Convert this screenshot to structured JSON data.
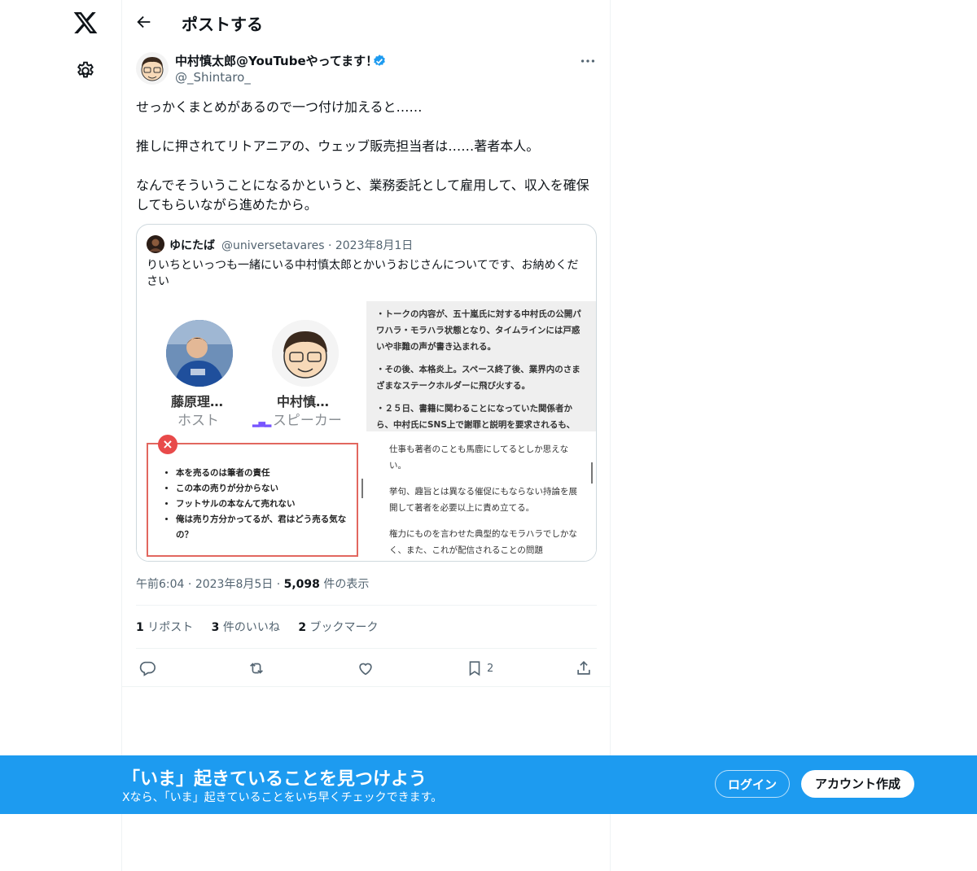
{
  "nav": {
    "logo_icon": "x-logo-icon",
    "settings_icon": "gear-icon"
  },
  "header": {
    "title": "ポストする",
    "back_icon": "arrow-left-icon"
  },
  "post": {
    "author_name": "中村慎太郎@YouTubeやってます！",
    "author_handle": "@_Shintaro_",
    "verified_icon": "verified-badge-icon",
    "more_icon": "more-dots-icon",
    "paragraphs": [
      "せっかくまとめがあるので一つ付け加えると……",
      "推しに押されてリトアニアの、ウェッブ販売担当者は……著者本人。",
      "なんでそういうことになるかというと、業務委託として雇用して、収入を確保してもらいながら進めたから。"
    ],
    "time": "午前6:04",
    "date": "2023年8月5日",
    "views_count": "5,098",
    "views_label": "件の表示",
    "stats": {
      "reposts_count": "1",
      "reposts_label": "リポスト",
      "likes_count": "3",
      "likes_label": "件のいいね",
      "bookmarks_count": "2",
      "bookmarks_label": "ブックマーク"
    },
    "actions": {
      "reply_icon": "reply-icon",
      "repost_icon": "repost-icon",
      "like_icon": "heart-icon",
      "bookmark_icon": "bookmark-icon",
      "bookmark_count": "2",
      "share_icon": "share-icon"
    }
  },
  "quote": {
    "name": "ゆにたば",
    "handle": "@universetavares",
    "date": "2023年8月1日",
    "text": "りいちといっつも一緒にいる中村慎太郎とかいうおじさんについてです、お納めください",
    "image": {
      "speaker1_name": "藤原理…",
      "speaker1_role": "ホスト",
      "speaker2_name": "中村慎…",
      "speaker2_role": "スピーカー",
      "x_mark": "×",
      "bullets": [
        "本を売るのは筆者の責任",
        "この本の売りが分からない",
        "フットサルの本なんて売れない",
        "俺は売り方分かってるが、君はどう売る気なの？"
      ],
      "doc_top": [
        "・トークの内容が、五十嵐氏に対する中村氏の公開パワハラ・モラハラ状態となり、タイムラインには戸惑いや非難の声が書き込まれる。",
        "・その後、本格炎上。スペース終了後、業界内のさまざまなステークホルダーに飛び火する。",
        "・２５日、書籍に関わることになっていた関係者から、中村氏にSNS上で謝罪と説明を要求されるも、"
      ],
      "doc_bottom": [
        "仕事も著者のことも馬鹿にしてるとしか思えない。",
        "挙句、趣旨とは異なる催促にもならない持論を展開して著者を必要以上に責め立てる。",
        "権力にものを言わせた典型的なモラハラでしかなく、また、これが配信されることの問題"
      ]
    }
  },
  "banner": {
    "title": "「いま」起きていることを見つけよう",
    "subtitle": "Xなら、「いま」起きていることをいち早くチェックできます。",
    "login_label": "ログイン",
    "signup_label": "アカウント作成"
  }
}
